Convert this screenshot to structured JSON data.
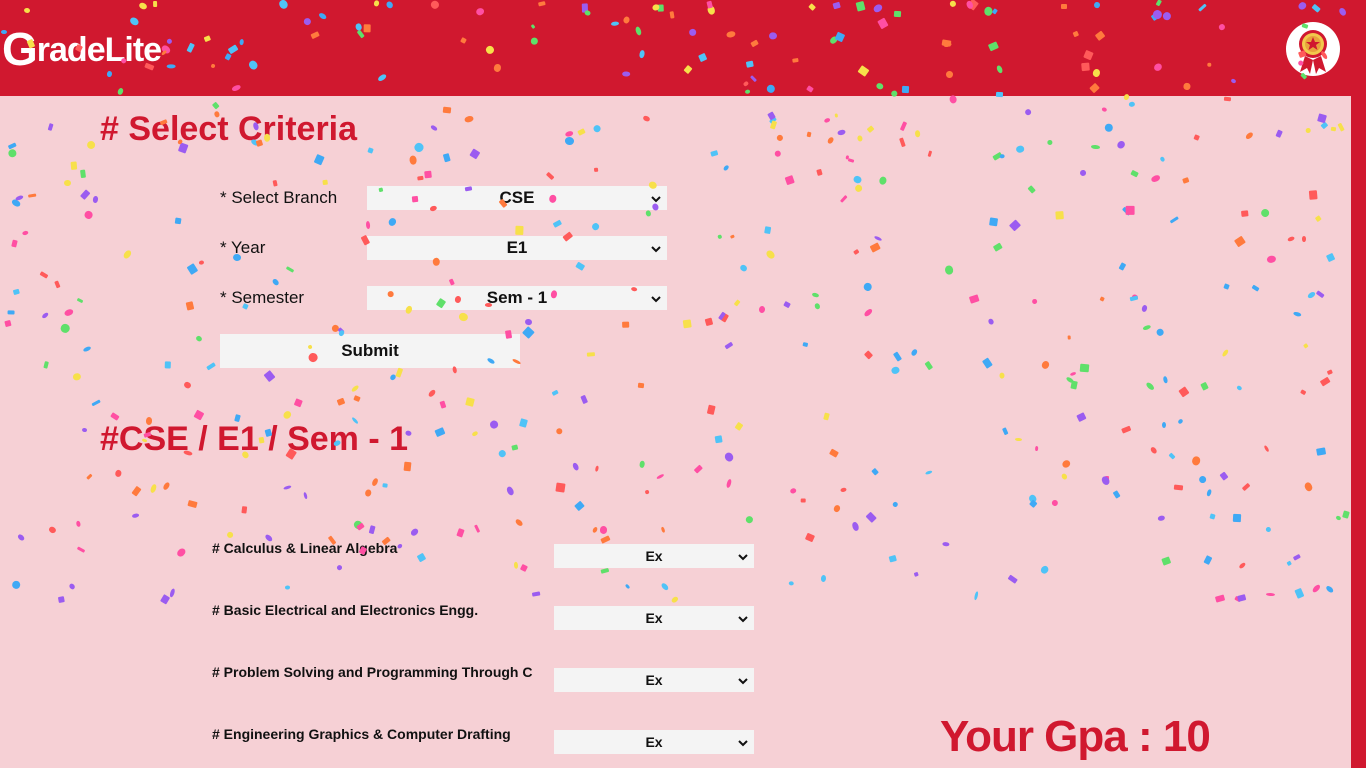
{
  "app": {
    "logo_first": "G",
    "logo_rest": "radeLite"
  },
  "criteria": {
    "title": "# Select Criteria",
    "branch_label": "* Select Branch",
    "branch_value": "CSE",
    "year_label": "* Year",
    "year_value": "E1",
    "semester_label": "* Semester",
    "semester_value": "Sem - 1",
    "submit_label": "Submit"
  },
  "results": {
    "title": "#CSE / E1 / Sem - 1",
    "subjects": [
      {
        "name": "# Calculus & Linear Algebra",
        "grade": "Ex"
      },
      {
        "name": "# Basic Electrical and Electronics Engg.",
        "grade": "Ex"
      },
      {
        "name": "# Problem Solving and Programming Through C",
        "grade": "Ex"
      },
      {
        "name": "# Engineering Graphics & Computer Drafting",
        "grade": "Ex"
      }
    ],
    "gpa_text": "Your Gpa : 10"
  },
  "colors": {
    "brand": "#d0182f",
    "background": "#f6d0d5",
    "field": "#f4f4f4"
  },
  "icons": {
    "badge": "award-ribbon-icon",
    "dropdown": "chevron-down-icon"
  }
}
